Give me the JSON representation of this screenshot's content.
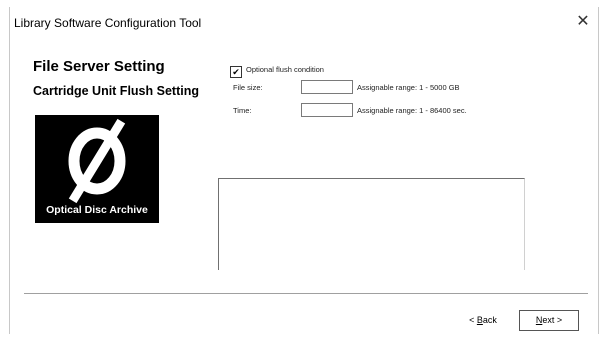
{
  "window": {
    "title": "Library Software Configuration Tool",
    "close_glyph": "✕"
  },
  "headings": {
    "main": "File Server Setting",
    "sub": "Cartridge Unit Flush Setting"
  },
  "logo": {
    "text": "Optical Disc Archive"
  },
  "options": {
    "optional_flush": {
      "label": "Optional flush condition",
      "checked": true,
      "check_glyph": "✔"
    },
    "file_size": {
      "label": "File size:",
      "value": "",
      "range": "Assignable range: 1 - 5000 GB"
    },
    "time": {
      "label": "Time:",
      "value": "",
      "range": "Assignable range: 1 - 86400 sec."
    }
  },
  "info_box": {
    "text": ""
  },
  "buttons": {
    "back": "< Back",
    "next": "Next >"
  }
}
